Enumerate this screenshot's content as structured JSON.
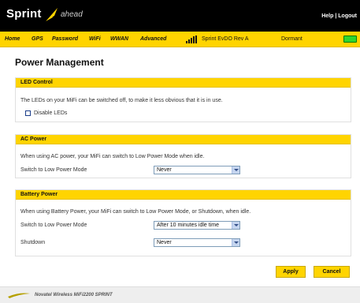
{
  "header": {
    "brand": "Sprint",
    "tagline": "ahead",
    "help_label": "Help",
    "separator": "|",
    "logout_label": "Logout"
  },
  "nav": {
    "items": [
      "Home",
      "GPS",
      "Password",
      "WiFi",
      "WWAN",
      "Advanced"
    ],
    "carrier": "Sprint  EvDO Rev A",
    "status": "Dormant"
  },
  "page": {
    "title": "Power Management"
  },
  "led": {
    "header": "LED Control",
    "description": "The LEDs on your MiFi can be switched off, to make it less obvious that it is in use.",
    "checkbox_label": "Disable LEDs",
    "checked": false
  },
  "ac": {
    "header": "AC Power",
    "description": "When using AC power, your MiFi can switch to Low Power Mode when idle.",
    "low_power_label": "Switch to Low Power Mode",
    "low_power_value": "Never"
  },
  "battery": {
    "header": "Battery Power",
    "description": "When using Battery Power, your MiFi can switch to Low Power Mode, or Shutdown, when idle.",
    "low_power_label": "Switch to Low Power Mode",
    "low_power_value": "After 10 minutes idle time",
    "shutdown_label": "Shutdown",
    "shutdown_value": "Never"
  },
  "buttons": {
    "apply": "Apply",
    "cancel": "Cancel"
  },
  "footer": {
    "text": "Novatel Wireless MiFi2200 SPRINT"
  },
  "colors": {
    "accent_yellow": "#ffd400",
    "header_black": "#000000",
    "battery_green": "#2fd62f"
  }
}
